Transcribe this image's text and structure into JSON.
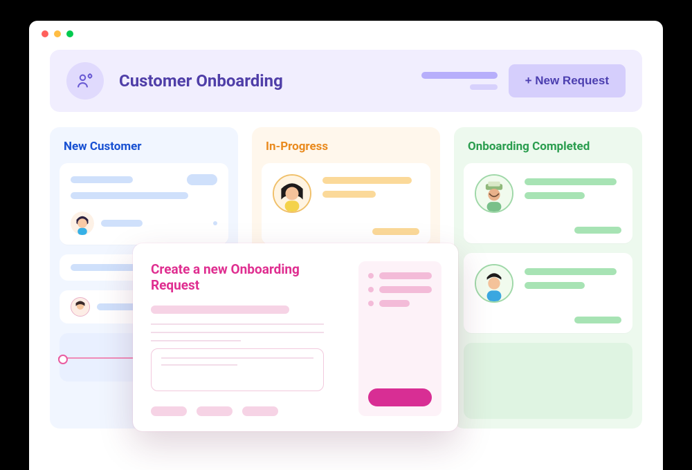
{
  "header": {
    "title": "Customer Onboarding",
    "newRequestLabel": "+ New Request"
  },
  "columns": {
    "new": {
      "title": "New Customer"
    },
    "progress": {
      "title": "In-Progress"
    },
    "done": {
      "title": "Onboarding Completed"
    }
  },
  "modal": {
    "title": "Create a new Onboarding Request"
  },
  "colors": {
    "purple": "#4F3EA8",
    "blue": "#1750D2",
    "orange": "#E98A1E",
    "green": "#2A9D4E",
    "pink": "#DF2E90"
  }
}
